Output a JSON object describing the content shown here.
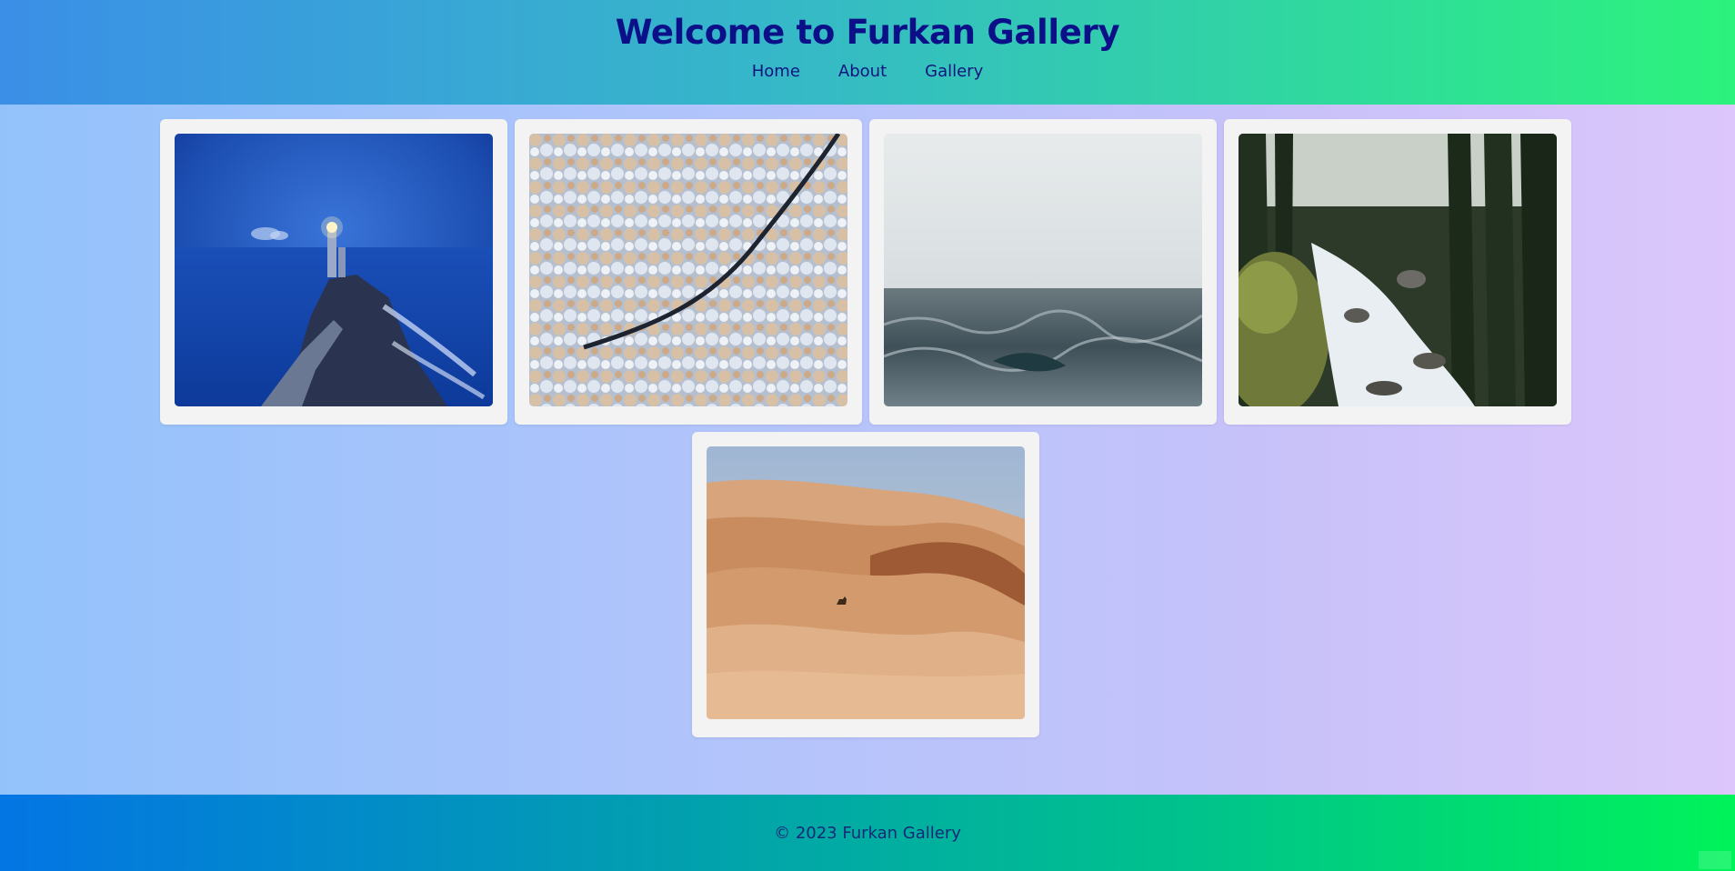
{
  "header": {
    "title": "Welcome to Furkan Gallery",
    "nav": [
      {
        "label": "Home"
      },
      {
        "label": "About"
      },
      {
        "label": "Gallery"
      }
    ]
  },
  "gallery": {
    "images": [
      {
        "subject": "lighthouse-at-night"
      },
      {
        "subject": "aerial-snowy-forest"
      },
      {
        "subject": "stormy-sea"
      },
      {
        "subject": "forest-river-rapids"
      },
      {
        "subject": "desert-dunes-camel"
      }
    ]
  },
  "footer": {
    "copyright": "© 2023 Furkan Gallery"
  },
  "colors": {
    "title": "#0b0f88",
    "card_bg": "#f3f3f3"
  }
}
